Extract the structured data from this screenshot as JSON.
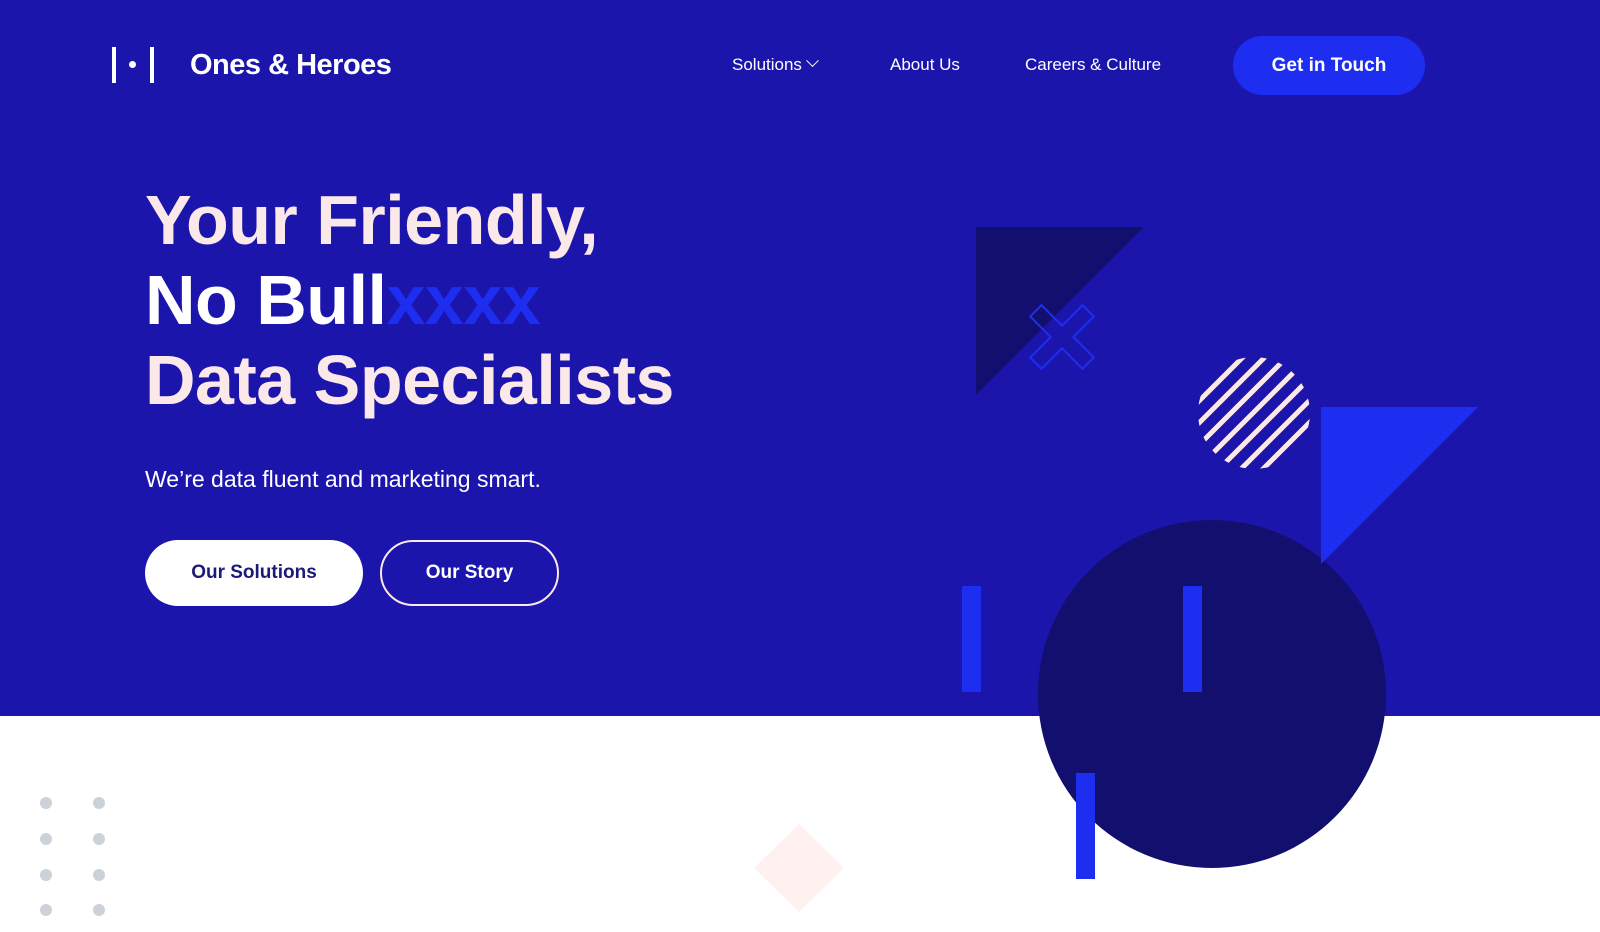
{
  "brand": {
    "name": "Ones & Heroes",
    "logo_icon": "bracket-dot-logo-icon"
  },
  "nav": {
    "items": [
      {
        "label": "Solutions",
        "has_dropdown": true,
        "icon": "chevron-down-icon"
      },
      {
        "label": "About Us"
      },
      {
        "label": "Careers & Culture"
      }
    ],
    "cta_label": "Get in Touch"
  },
  "hero": {
    "headline": {
      "line1": "Your Friendly,",
      "line2_main": "No Bull",
      "line2_accent": "xxxx",
      "line3": "Data Specialists"
    },
    "subtitle": "We’re data fluent and marketing smart.",
    "primary_button": "Our Solutions",
    "secondary_button": "Our Story"
  },
  "colors": {
    "hero_bg": "#1b15ab",
    "accent_blue": "#1e2ef0",
    "navy": "#120f6e",
    "blush": "#fbe9ea",
    "dot_gray": "#cdd2d8",
    "diamond_pink": "#fff1f0"
  },
  "decorations": [
    "dark-triangle",
    "outline-x-icon",
    "striped-circle",
    "bright-triangle",
    "navy-circle",
    "vertical-bar",
    "vertical-bar",
    "vertical-bar",
    "dot-grid",
    "pink-diamond"
  ]
}
